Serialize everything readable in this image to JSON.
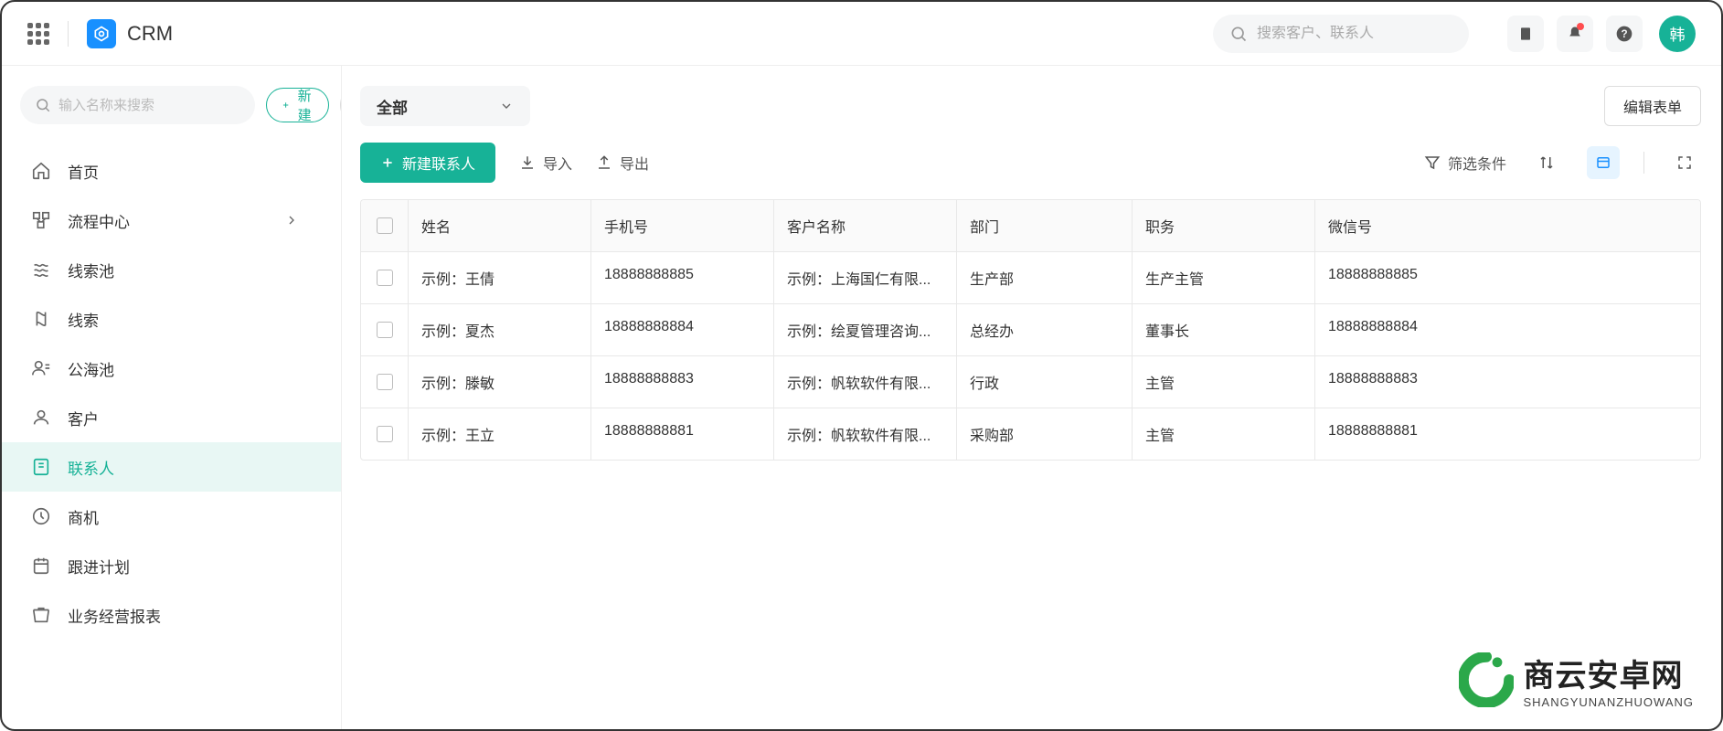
{
  "header": {
    "app_title": "CRM",
    "search_placeholder": "搜索客户、联系人",
    "avatar_text": "韩"
  },
  "sidebar": {
    "search_placeholder": "输入名称来搜索",
    "new_button": "新建",
    "items": [
      {
        "label": "首页",
        "icon": "home"
      },
      {
        "label": "流程中心",
        "icon": "flow",
        "has_chevron": true
      },
      {
        "label": "线索池",
        "icon": "pool"
      },
      {
        "label": "线索",
        "icon": "lead"
      },
      {
        "label": "公海池",
        "icon": "sea"
      },
      {
        "label": "客户",
        "icon": "customer"
      },
      {
        "label": "联系人",
        "icon": "contact",
        "active": true
      },
      {
        "label": "商机",
        "icon": "opportunity"
      },
      {
        "label": "跟进计划",
        "icon": "plan"
      },
      {
        "label": "业务经营报表",
        "icon": "report"
      }
    ]
  },
  "main": {
    "filter_dropdown": "全部",
    "edit_form_btn": "编辑表单",
    "new_contact_btn": "新建联系人",
    "import_btn": "导入",
    "export_btn": "导出",
    "filter_label": "筛选条件",
    "columns": [
      "姓名",
      "手机号",
      "客户名称",
      "部门",
      "职务",
      "微信号"
    ],
    "rows": [
      {
        "name": "示例：王倩",
        "phone": "18888888885",
        "customer": "示例：上海国仁有限...",
        "dept": "生产部",
        "position": "生产主管",
        "wechat": "18888888885"
      },
      {
        "name": "示例：夏杰",
        "phone": "18888888884",
        "customer": "示例：绘夏管理咨询...",
        "dept": "总经办",
        "position": "董事长",
        "wechat": "18888888884"
      },
      {
        "name": "示例：滕敏",
        "phone": "18888888883",
        "customer": "示例：帆软软件有限...",
        "dept": "行政",
        "position": "主管",
        "wechat": "18888888883"
      },
      {
        "name": "示例：王立",
        "phone": "18888888881",
        "customer": "示例：帆软软件有限...",
        "dept": "采购部",
        "position": "主管",
        "wechat": "18888888881"
      }
    ]
  },
  "watermark": {
    "cn": "商云安卓网",
    "en": "SHANGYUNANZHUOWANG"
  }
}
